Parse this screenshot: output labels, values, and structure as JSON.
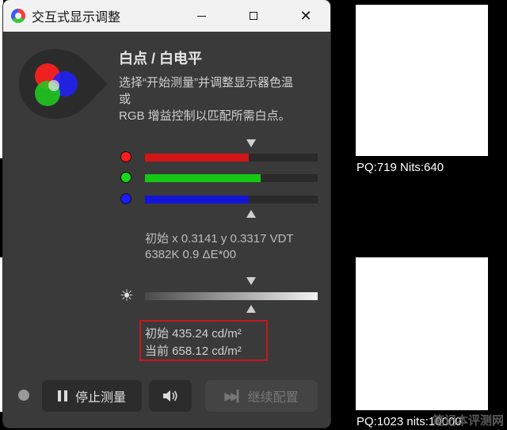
{
  "window": {
    "title": "交互式显示调整",
    "controls": {
      "minimize": "minimize",
      "maximize": "maximize",
      "close": "✕"
    }
  },
  "header": {
    "heading": "白点 / 白电平",
    "description_lines": [
      "选择“开始测量”并调整显示器色温",
      "或",
      "RGB 增益控制以匹配所需白点。"
    ]
  },
  "rgb_sliders": [
    {
      "channel": "red",
      "color": "#ff1b1b",
      "bar_color": "#d41515",
      "level": 0.6
    },
    {
      "channel": "green",
      "color": "#1bd61b",
      "bar_color": "#14c814",
      "level": 0.67
    },
    {
      "channel": "blue",
      "color": "#1b1bff",
      "bar_color": "#1414d9",
      "level": 0.6
    }
  ],
  "whitepoint_readout": {
    "line1": "初始 x 0.3141 y 0.3317 VDT",
    "line2": "6382K 0.9 ΔE*00"
  },
  "luminance": {
    "line1": "初始 435.24 cd/m²",
    "line2": "当前 658.12 cd/m²"
  },
  "bottom_bar": {
    "stop_label": "停止测量",
    "continue_label": "继续配置",
    "sound_icon": "speaker-icon"
  },
  "patches": {
    "top_label": "PQ:719  Nits:640",
    "bottom_label": "PQ:1023 nits:10000"
  },
  "watermark": "笔记本评测网",
  "colors": {
    "highlight": "#c8161d",
    "window_bg": "#3a3a3a"
  }
}
